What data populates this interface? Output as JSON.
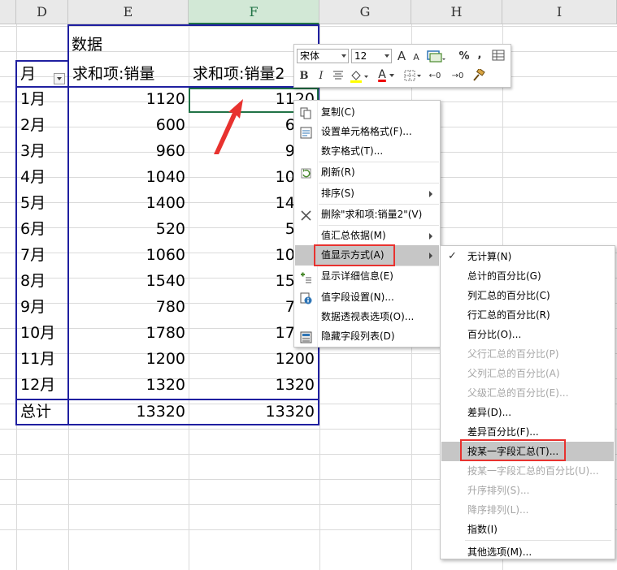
{
  "columns": [
    "D",
    "E",
    "F",
    "G",
    "H",
    "I"
  ],
  "selected_column": "F",
  "pivot": {
    "data_label": "数据",
    "header_month": "月",
    "header_sum1": "求和项:销量",
    "header_sum2": "求和项:销量2",
    "rows": [
      {
        "month": "1月",
        "v1": "1120",
        "v2": "1120"
      },
      {
        "month": "2月",
        "v1": "600",
        "v2": "600"
      },
      {
        "month": "3月",
        "v1": "960",
        "v2": "960"
      },
      {
        "month": "4月",
        "v1": "1040",
        "v2": "1040"
      },
      {
        "month": "5月",
        "v1": "1400",
        "v2": "1400"
      },
      {
        "month": "6月",
        "v1": "520",
        "v2": "520"
      },
      {
        "month": "7月",
        "v1": "1060",
        "v2": "1060"
      },
      {
        "month": "8月",
        "v1": "1540",
        "v2": "1540"
      },
      {
        "month": "9月",
        "v1": "780",
        "v2": "780"
      },
      {
        "month": "10月",
        "v1": "1780",
        "v2": "1780"
      },
      {
        "month": "11月",
        "v1": "1200",
        "v2": "1200"
      },
      {
        "month": "12月",
        "v1": "1320",
        "v2": "1320"
      }
    ],
    "total_label": "总计",
    "total_v1": "13320",
    "total_v2": "13320"
  },
  "mini_toolbar": {
    "font_name": "宋体",
    "font_size": "12",
    "grow_font": "A",
    "shrink_font": "A",
    "percent": "%",
    "comma": ",",
    "bold": "B",
    "italic": "I",
    "font_color_letter": "A",
    "dec_increase": "←0",
    "dec_decrease": "→0"
  },
  "context_menu": {
    "items": [
      {
        "label": "复制(C)",
        "icon": "copy-icon"
      },
      {
        "label": "设置单元格格式(F)...",
        "icon": "format-cells-icon"
      },
      {
        "label": "数字格式(T)..."
      },
      {
        "label": "刷新(R)",
        "icon": "refresh-icon"
      },
      {
        "label": "排序(S)",
        "submenu": true
      },
      {
        "label": "删除\"求和项:销量2\"(V)",
        "icon": "delete-x-icon"
      },
      {
        "label": "值汇总依据(M)",
        "submenu": true
      },
      {
        "label": "值显示方式(A)",
        "submenu": true,
        "highlighted": true
      },
      {
        "label": "显示详细信息(E)",
        "icon": "show-details-icon"
      },
      {
        "label": "值字段设置(N)...",
        "icon": "field-settings-icon"
      },
      {
        "label": "数据透视表选项(O)..."
      },
      {
        "label": "隐藏字段列表(D)",
        "icon": "field-list-icon"
      }
    ]
  },
  "submenu": {
    "items": [
      {
        "label": "无计算(N)",
        "checked": true
      },
      {
        "label": "总计的百分比(G)"
      },
      {
        "label": "列汇总的百分比(C)"
      },
      {
        "label": "行汇总的百分比(R)"
      },
      {
        "label": "百分比(O)..."
      },
      {
        "label": "父行汇总的百分比(P)",
        "disabled": true
      },
      {
        "label": "父列汇总的百分比(A)",
        "disabled": true
      },
      {
        "label": "父级汇总的百分比(E)...",
        "disabled": true
      },
      {
        "label": "差异(D)..."
      },
      {
        "label": "差异百分比(F)..."
      },
      {
        "label": "按某一字段汇总(T)...",
        "highlighted": true
      },
      {
        "label": "按某一字段汇总的百分比(U)...",
        "disabled": true
      },
      {
        "label": "升序排列(S)...",
        "disabled": true
      },
      {
        "label": "降序排列(L)...",
        "disabled": true
      },
      {
        "label": "指数(I)"
      },
      {
        "label": "其他选项(M)..."
      }
    ]
  },
  "colors": {
    "pivot_border": "#1f1fa0",
    "selection_green": "#217346",
    "annotation_red": "#e8322f",
    "menu_highlight": "#c6c6c6"
  }
}
